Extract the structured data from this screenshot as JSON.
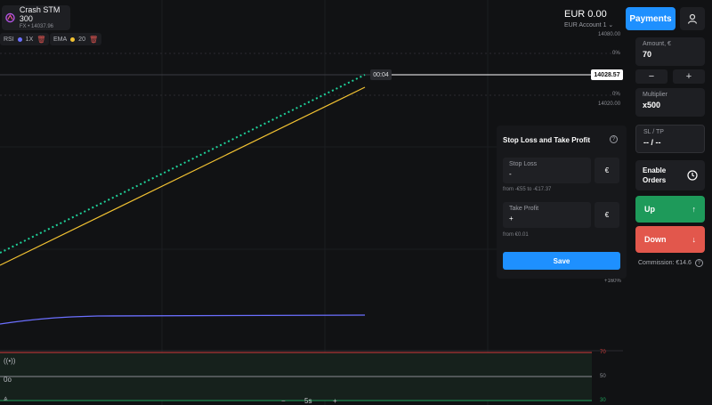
{
  "asset": {
    "name": "Crash STM 300",
    "sub": "FX • 14037.96"
  },
  "indicators": [
    {
      "name": "RSI",
      "value": "1X",
      "color": "#6b6fff"
    },
    {
      "name": "EMA",
      "value": "20",
      "color": "#f2c232"
    }
  ],
  "account": {
    "balance": "EUR 0.00",
    "name": "EUR Account 1",
    "payments_label": "Payments"
  },
  "chart": {
    "price_tag": "14028.57",
    "time_tag": "00:04",
    "scale_labels": {
      "top": "14080.00",
      "pct1": "0%",
      "pct2": "0%",
      "mid": "14020.00",
      "bottom_pct": "+160%"
    },
    "osc_labels": {
      "top": "70",
      "mid": "50",
      "low": "30"
    },
    "bottom": {
      "minus": "−",
      "timeframe": "5s",
      "plus": "+"
    },
    "colors": {
      "price": "#1fd19a",
      "ema": "#f2c232",
      "rsi": "#6b6fff"
    }
  },
  "panel": {
    "amount": {
      "label": "Amount, €",
      "value": "70"
    },
    "stepper": {
      "minus": "−",
      "plus": "+"
    },
    "multiplier": {
      "label": "Multiplier",
      "value": "x500"
    },
    "sltp": {
      "label": "SL / TP",
      "value": "-- / --"
    },
    "orders": {
      "label_line1": "Enable",
      "label_line2": "Orders"
    },
    "up": {
      "label": "Up",
      "arrow": "↑"
    },
    "down": {
      "label": "Down",
      "arrow": "↓"
    },
    "commission": "Commission: €14.6",
    "help": "?"
  },
  "popup": {
    "title": "Stop Loss and Take Profit",
    "help": "?",
    "stop_loss": {
      "label": "Stop Loss",
      "value": "-",
      "currency": "€",
      "hint": "from -€55 to -€17.37"
    },
    "take_profit": {
      "label": "Take Profit",
      "value": "+",
      "currency": "€",
      "hint": "from €0.01"
    },
    "save_label": "Save"
  }
}
